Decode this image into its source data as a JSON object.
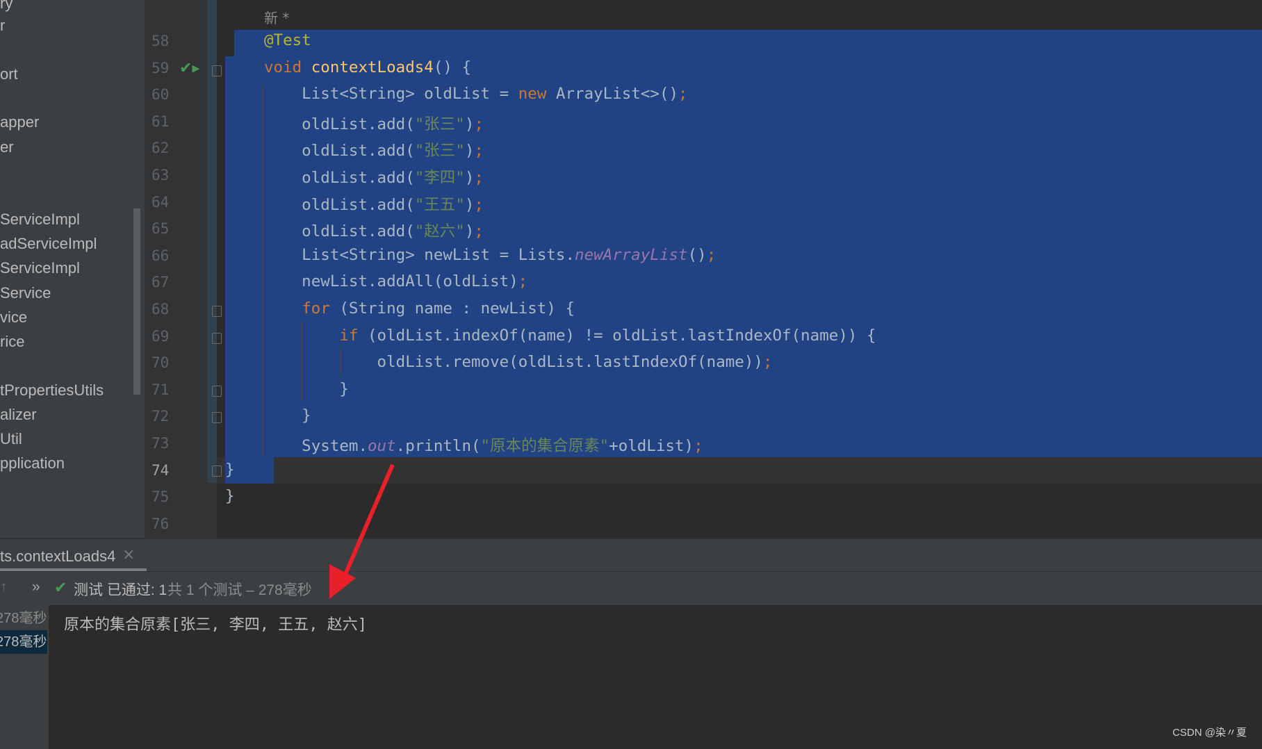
{
  "sidebar": {
    "items": [
      "ry",
      "r",
      "ort",
      "apper",
      "er",
      "ServiceImpl",
      "adServiceImpl",
      "ServiceImpl",
      "Service",
      "vice",
      "rice",
      "tPropertiesUtils",
      "alizer",
      "Util",
      "pplication"
    ]
  },
  "editor": {
    "new_hint": "新 *",
    "line_numbers": [
      "58",
      "59",
      "60",
      "61",
      "62",
      "63",
      "64",
      "65",
      "66",
      "67",
      "68",
      "69",
      "70",
      "71",
      "72",
      "73",
      "74",
      "75",
      "76"
    ],
    "current_line": "74",
    "lines": [
      [
        [
          "@Test",
          "an"
        ]
      ],
      [
        [
          "void ",
          "kw"
        ],
        [
          "contextLoads4",
          "fn"
        ],
        [
          "() {",
          "pl"
        ]
      ],
      [
        [
          "    List<String> oldList = ",
          "pl"
        ],
        [
          "new ",
          "kw"
        ],
        [
          "ArrayList<>()",
          "pl"
        ],
        [
          ";",
          "kw"
        ]
      ],
      [
        [
          "    oldList.add(",
          "pl"
        ],
        [
          "\"张三\"",
          "st"
        ],
        [
          ")",
          "pl"
        ],
        [
          ";",
          "kw"
        ]
      ],
      [
        [
          "    oldList.add(",
          "pl"
        ],
        [
          "\"张三\"",
          "st"
        ],
        [
          ")",
          "pl"
        ],
        [
          ";",
          "kw"
        ]
      ],
      [
        [
          "    oldList.add(",
          "pl"
        ],
        [
          "\"李四\"",
          "st"
        ],
        [
          ")",
          "pl"
        ],
        [
          ";",
          "kw"
        ]
      ],
      [
        [
          "    oldList.add(",
          "pl"
        ],
        [
          "\"王五\"",
          "st"
        ],
        [
          ")",
          "pl"
        ],
        [
          ";",
          "kw"
        ]
      ],
      [
        [
          "    oldList.add(",
          "pl"
        ],
        [
          "\"赵六\"",
          "st"
        ],
        [
          ")",
          "pl"
        ],
        [
          ";",
          "kw"
        ]
      ],
      [
        [
          "    List<String> newList = Lists.",
          "pl"
        ],
        [
          "newArrayList",
          "it"
        ],
        [
          "()",
          "pl"
        ],
        [
          ";",
          "kw"
        ]
      ],
      [
        [
          "    newList.addAll(oldList)",
          "pl"
        ],
        [
          ";",
          "kw"
        ]
      ],
      [
        [
          "    ",
          "pl"
        ],
        [
          "for ",
          "kw"
        ],
        [
          "(String name : newList) {",
          "pl"
        ]
      ],
      [
        [
          "        ",
          "pl"
        ],
        [
          "if ",
          "kw"
        ],
        [
          "(oldList.indexOf(name) != oldList.lastIndexOf(name)) {",
          "pl"
        ]
      ],
      [
        [
          "            oldList.remove(oldList.lastIndexOf(name))",
          "pl"
        ],
        [
          ";",
          "kw"
        ]
      ],
      [
        [
          "        }",
          "pl"
        ]
      ],
      [
        [
          "    }",
          "pl"
        ]
      ],
      [
        [
          "    System.",
          "pl"
        ],
        [
          "out",
          "it"
        ],
        [
          ".println(",
          "pl"
        ],
        [
          "\"原本的集合原素\"",
          "st"
        ],
        [
          "+oldList)",
          "pl"
        ],
        [
          ";",
          "kw"
        ]
      ],
      [
        [
          "}",
          "pl"
        ]
      ],
      [
        [
          "}",
          "pl"
        ]
      ],
      [
        [
          "",
          "pl"
        ]
      ]
    ]
  },
  "run_panel": {
    "tab_label": "ts.contextLoads4",
    "tab_close": "×",
    "up_icon": "↑",
    "more_icon": "»",
    "status_passed": "测试 已通过: 1",
    "status_detail": "共 1 个测试 – 278毫秒",
    "tree_items": [
      "278毫秒",
      "278毫秒"
    ],
    "console_output": "原本的集合原素[张三, 李四, 王五, 赵六]"
  },
  "colors": {
    "selection": "#214283",
    "keyword": "#cc7832",
    "string": "#6a8759",
    "method": "#ffc66d",
    "annotation": "#bbb529",
    "pass": "#499c54",
    "arrow": "#e8202a"
  },
  "watermark": "CSDN @染〃夏"
}
